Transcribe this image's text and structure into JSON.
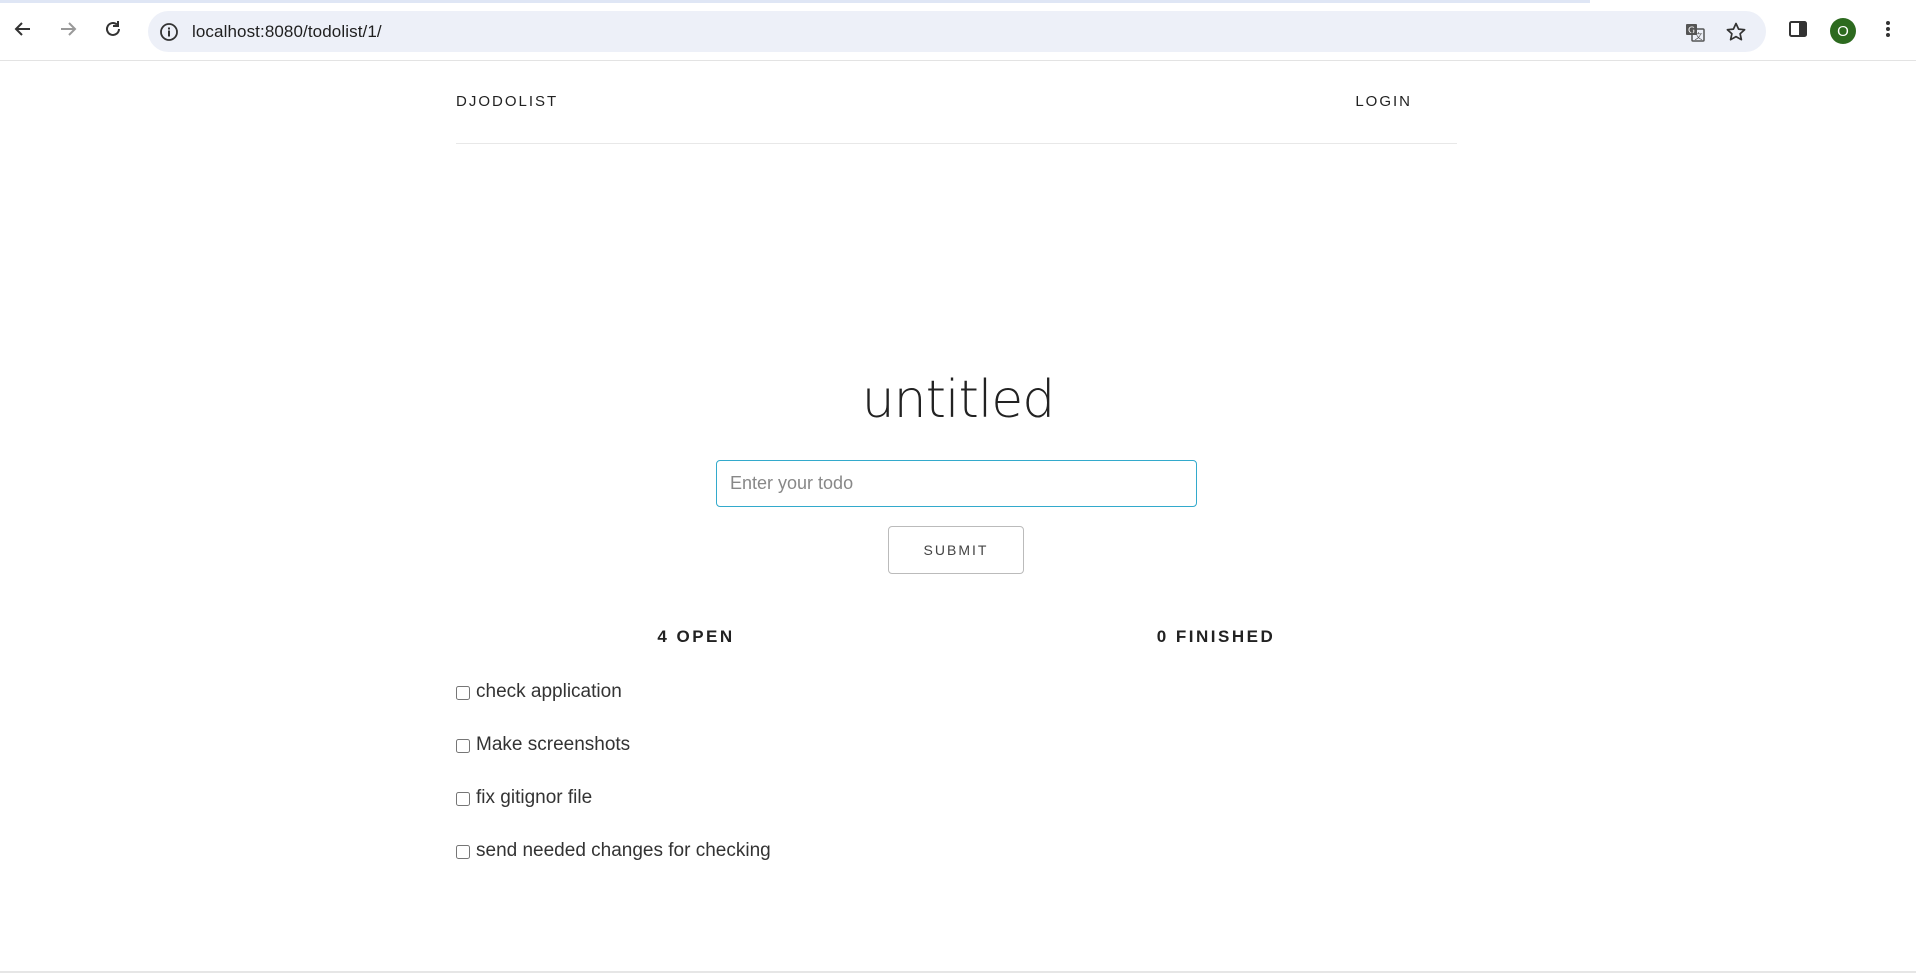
{
  "browser": {
    "url": "localhost:8080/todolist/1/",
    "profile_initial": "O"
  },
  "header": {
    "brand": "DJODOLIST",
    "login": "LOGIN"
  },
  "list": {
    "title": "untitled",
    "input_placeholder": "Enter your todo",
    "input_value": "",
    "submit_label": "SUBMIT"
  },
  "open": {
    "heading": "4 OPEN",
    "items": [
      {
        "text": "check application",
        "checked": false
      },
      {
        "text": "Make screenshots",
        "checked": false
      },
      {
        "text": "fix gitignor file",
        "checked": false
      },
      {
        "text": "send needed changes for checking",
        "checked": false
      }
    ]
  },
  "finished": {
    "heading": "0 FINISHED",
    "items": []
  }
}
